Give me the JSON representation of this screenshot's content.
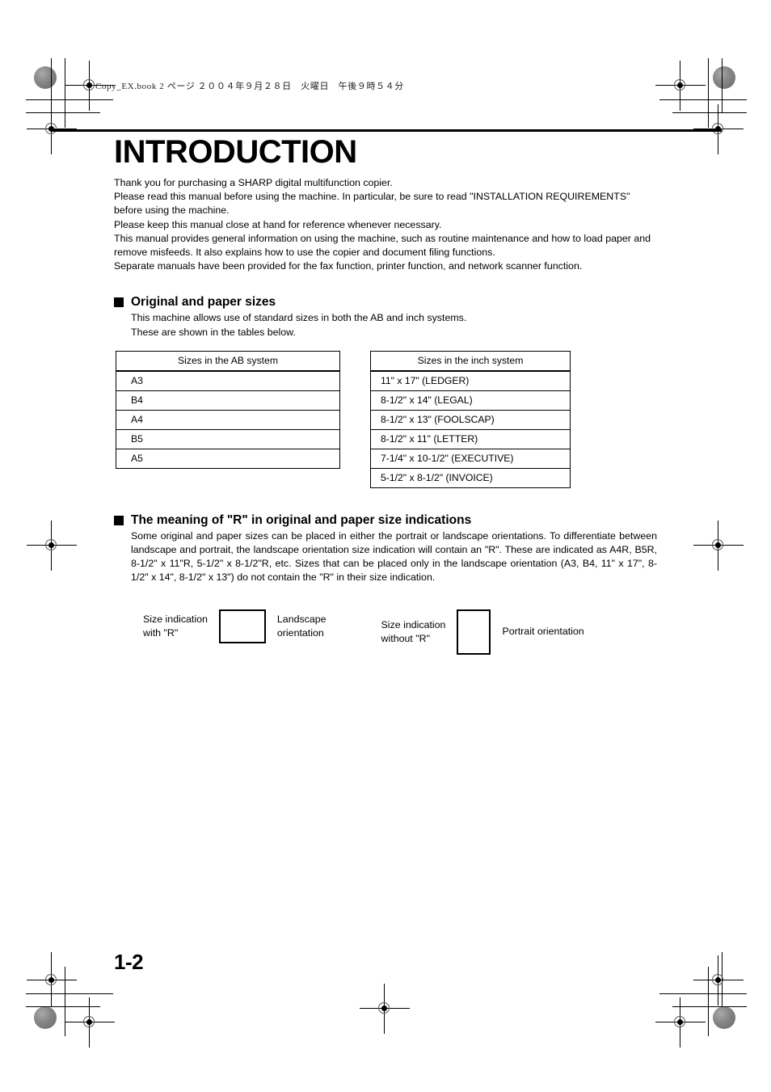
{
  "header": {
    "print_meta": "Copy_EX.book  2 ページ  ２００４年９月２８日　火曜日　午後９時５４分"
  },
  "page": {
    "title": "INTRODUCTION",
    "page_number": "1-2"
  },
  "intro": {
    "lines": [
      "Thank you for purchasing a SHARP digital multifunction copier.",
      "Please read this manual before using the machine. In particular, be sure to read \"INSTALLATION REQUIREMENTS\" before using the machine.",
      "Please keep this manual close at hand for reference whenever necessary.",
      "This manual provides general information on using the machine, such as routine maintenance and how to load paper and remove misfeeds. It also explains how to use the copier and document filing functions.",
      "Separate manuals have been provided for the fax function, printer function, and network scanner function."
    ]
  },
  "sections": [
    {
      "title": "Original and paper sizes",
      "body": [
        "This machine allows use of standard sizes in both the AB and inch systems.",
        "These are shown in the tables below."
      ]
    },
    {
      "title": "The meaning of \"R\" in original and paper size indications",
      "body": [
        "Some original and paper sizes can be placed in either the portrait or landscape orientations. To differentiate between landscape and portrait, the landscape orientation size indication will contain an \"R\". These are indicated as A4R, B5R, 8-1/2\" x 11\"R, 5-1/2\" x 8-1/2\"R, etc. Sizes that can be placed only in the landscape orientation (A3, B4, 11\" x 17\", 8-1/2\" x 14\", 8-1/2\" x 13\") do not contain the \"R\" in their size indication."
      ]
    }
  ],
  "tables": {
    "ab": {
      "header": "Sizes in the AB system",
      "rows": [
        "A3",
        "B4",
        "A4",
        "B5",
        "A5"
      ]
    },
    "inch": {
      "header": "Sizes in the inch system",
      "rows": [
        "11\" x 17\" (LEDGER)",
        "8-1/2\" x 14\" (LEGAL)",
        "8-1/2\" x 13\" (FOOLSCAP)",
        "8-1/2\" x 11\" (LETTER)",
        "7-1/4\" x 10-1/2\" (EXECUTIVE)",
        "5-1/2\" x 8-1/2\" (INVOICE)"
      ]
    }
  },
  "orientation_diagram": {
    "landscape": {
      "label_line1": "Size indication",
      "label_line2": "with \"R\"",
      "caption_line1": "Landscape",
      "caption_line2": "orientation"
    },
    "portrait": {
      "label_line1": "Size indication",
      "label_line2": "without \"R\"",
      "caption": "Portrait orientation"
    }
  }
}
